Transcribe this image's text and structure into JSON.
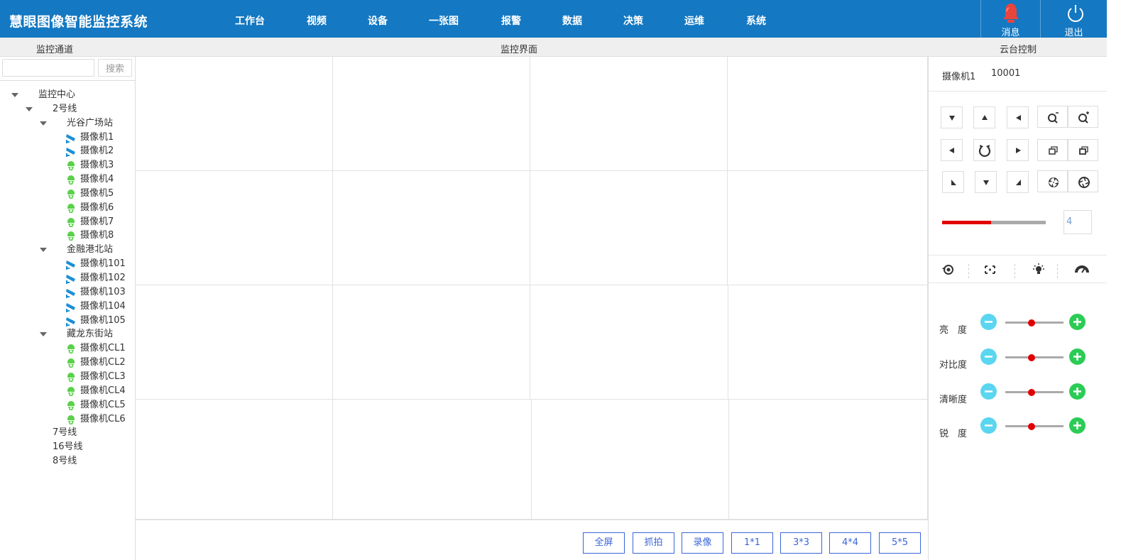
{
  "header": {
    "app_title": "慧眼图像智能监控系统",
    "nav": [
      "工作台",
      "视频",
      "设备",
      "一张图",
      "报警",
      "数据",
      "决策",
      "运维",
      "系统"
    ],
    "message_label": "消息",
    "logout_label": "退出"
  },
  "sections": {
    "left_title": "监控通道",
    "center_title": "监控界面",
    "right_title": "云台控制"
  },
  "search": {
    "value": "",
    "button_label": "搜索"
  },
  "tree": {
    "root": "监控中心",
    "lines": [
      {
        "label": "2号线",
        "stations": [
          {
            "label": "光谷广场站",
            "cameras": [
              {
                "label": "摄像机1",
                "type": "bullet"
              },
              {
                "label": "摄像机2",
                "type": "bullet"
              },
              {
                "label": "摄像机3",
                "type": "dome"
              },
              {
                "label": "摄像机4",
                "type": "dome"
              },
              {
                "label": "摄像机5",
                "type": "dome"
              },
              {
                "label": "摄像机6",
                "type": "dome"
              },
              {
                "label": "摄像机7",
                "type": "dome"
              },
              {
                "label": "摄像机8",
                "type": "dome"
              }
            ]
          },
          {
            "label": "金融港北站",
            "cameras": [
              {
                "label": "摄像机101",
                "type": "bullet"
              },
              {
                "label": "摄像机102",
                "type": "bullet"
              },
              {
                "label": "摄像机103",
                "type": "bullet"
              },
              {
                "label": "摄像机104",
                "type": "bullet"
              },
              {
                "label": "摄像机105",
                "type": "bullet"
              }
            ]
          },
          {
            "label": "藏龙东街站",
            "cameras": [
              {
                "label": "摄像机CL1",
                "type": "dome"
              },
              {
                "label": "摄像机CL2",
                "type": "dome"
              },
              {
                "label": "摄像机CL3",
                "type": "dome"
              },
              {
                "label": "摄像机CL4",
                "type": "dome"
              },
              {
                "label": "摄像机CL5",
                "type": "dome"
              },
              {
                "label": "摄像机CL6",
                "type": "dome"
              }
            ]
          }
        ]
      },
      {
        "label": "7号线",
        "stations": []
      },
      {
        "label": "16号线",
        "stations": []
      },
      {
        "label": "8号线",
        "stations": []
      }
    ]
  },
  "bottom_buttons": [
    "全屏",
    "抓拍",
    "录像",
    "1*1",
    "3*3",
    "4*4",
    "5*5"
  ],
  "ptz": {
    "camera_name": "摄像机1",
    "camera_id": "10001",
    "speed_level": 0.47,
    "speed_value": "4"
  },
  "adjustments": [
    {
      "label": "亮　度",
      "level": 0.45
    },
    {
      "label": "对比度",
      "level": 0.45
    },
    {
      "label": "清晰度",
      "level": 0.45
    },
    {
      "label": "锐　度",
      "level": 0.45
    }
  ],
  "colors": {
    "header_bg": "#1478c2",
    "accent": "#3a66d6",
    "alert_red": "#e8453c",
    "camera_bullet": "#1a8fd6",
    "camera_dome": "#5ad14a",
    "minus_circle": "#5ad6f0",
    "plus_circle": "#2bcc55",
    "slider_fill": "#e10000"
  }
}
